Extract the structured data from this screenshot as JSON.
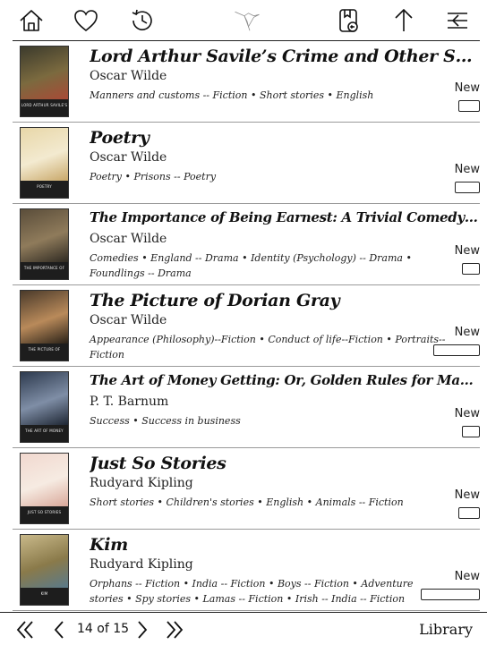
{
  "toolbar": {
    "icons": [
      "home-icon",
      "heart-icon",
      "history-icon",
      "logo-bird-icon",
      "bookmark-back-icon",
      "up-arrow-icon",
      "menu-close-icon"
    ]
  },
  "books": [
    {
      "title": "Lord Arthur Savile’s Crime and Other Stories",
      "author": "Oscar Wilde",
      "subjects": "Manners and customs -- Fiction • Short stories • English",
      "status": "New",
      "progress": 0
    },
    {
      "title": "Poetry",
      "author": "Oscar Wilde",
      "subjects": "Poetry • Prisons -- Poetry",
      "status": "New",
      "progress": 0
    },
    {
      "title": "The Importance of Being Earnest: A Trivial Comedy for...",
      "author": "Oscar Wilde",
      "subjects": "Comedies • England -- Drama • Identity (Psychology) -- Drama • Foundlings -- Drama",
      "status": "New",
      "progress": 0
    },
    {
      "title": "The Picture of Dorian Gray",
      "author": "Oscar Wilde",
      "subjects": "Appearance (Philosophy)--Fiction • Conduct of life--Fiction • Portraits--Fiction",
      "status": "New",
      "progress": 0
    },
    {
      "title": "The Art of Money Getting: Or, Golden Rules for Making...",
      "author": "P. T. Barnum",
      "subjects": "Success • Success in business",
      "status": "New",
      "progress": 0
    },
    {
      "title": "Just So Stories",
      "author": "Rudyard Kipling",
      "subjects": "Short stories • Children's stories • English • Animals -- Fiction",
      "status": "New",
      "progress": 0
    },
    {
      "title": "Kim",
      "author": "Rudyard Kipling",
      "subjects": "Orphans -- Fiction • India -- Fiction • Boys -- Fiction • Adventure stories • Spy stories • Lamas -- Fiction • Irish -- India -- Fiction",
      "status": "New",
      "progress": 0
    }
  ],
  "covers": [
    {
      "band": "LORD ARTHUR SAVILE'S CRIME AND OTHER STORIES",
      "colors": [
        "#3b3a2c",
        "#7b6a3f",
        "#a84a36"
      ]
    },
    {
      "band": "POETRY",
      "colors": [
        "#e8d7a8",
        "#f3ead0",
        "#c9a86a"
      ]
    },
    {
      "band": "THE IMPORTANCE OF BEING EARNEST",
      "colors": [
        "#5a4d3a",
        "#8f7b5b",
        "#2f2a22"
      ]
    },
    {
      "band": "THE PICTURE OF DORIAN GRAY",
      "colors": [
        "#4a3a2a",
        "#b98a5a",
        "#2a2218"
      ]
    },
    {
      "band": "THE ART OF MONEY GETTING",
      "colors": [
        "#2d3a4e",
        "#7f8ea6",
        "#1e2633"
      ]
    },
    {
      "band": "JUST SO STORIES",
      "colors": [
        "#f1d8cf",
        "#f6ebe2",
        "#d9a89a"
      ]
    },
    {
      "band": "KIM",
      "colors": [
        "#c9b98a",
        "#8a7a4a",
        "#5a7a8a"
      ]
    }
  ],
  "pager": {
    "page_text": "14 of 15",
    "library_label": "Library"
  }
}
